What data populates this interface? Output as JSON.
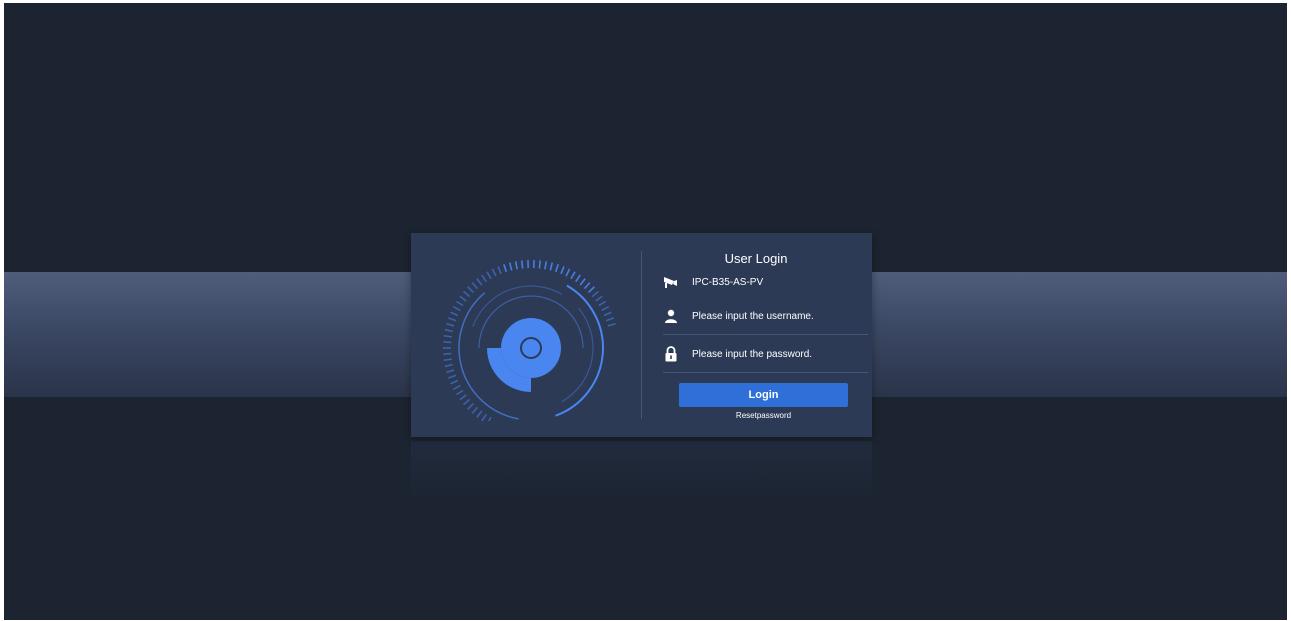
{
  "login": {
    "title": "User Login",
    "device_name": "IPC-B35-AS-PV",
    "username_placeholder": "Please input the username.",
    "password_placeholder": "Please input the password.",
    "login_label": "Login",
    "reset_label": "Resetpassword"
  },
  "icons": {
    "device": "camera-icon",
    "username": "user-icon",
    "password": "lock-icon"
  },
  "colors": {
    "background": "#1c2431",
    "card": "#2c3a56",
    "accent": "#2f6fd8",
    "logo_blue": "#4a86f0"
  }
}
